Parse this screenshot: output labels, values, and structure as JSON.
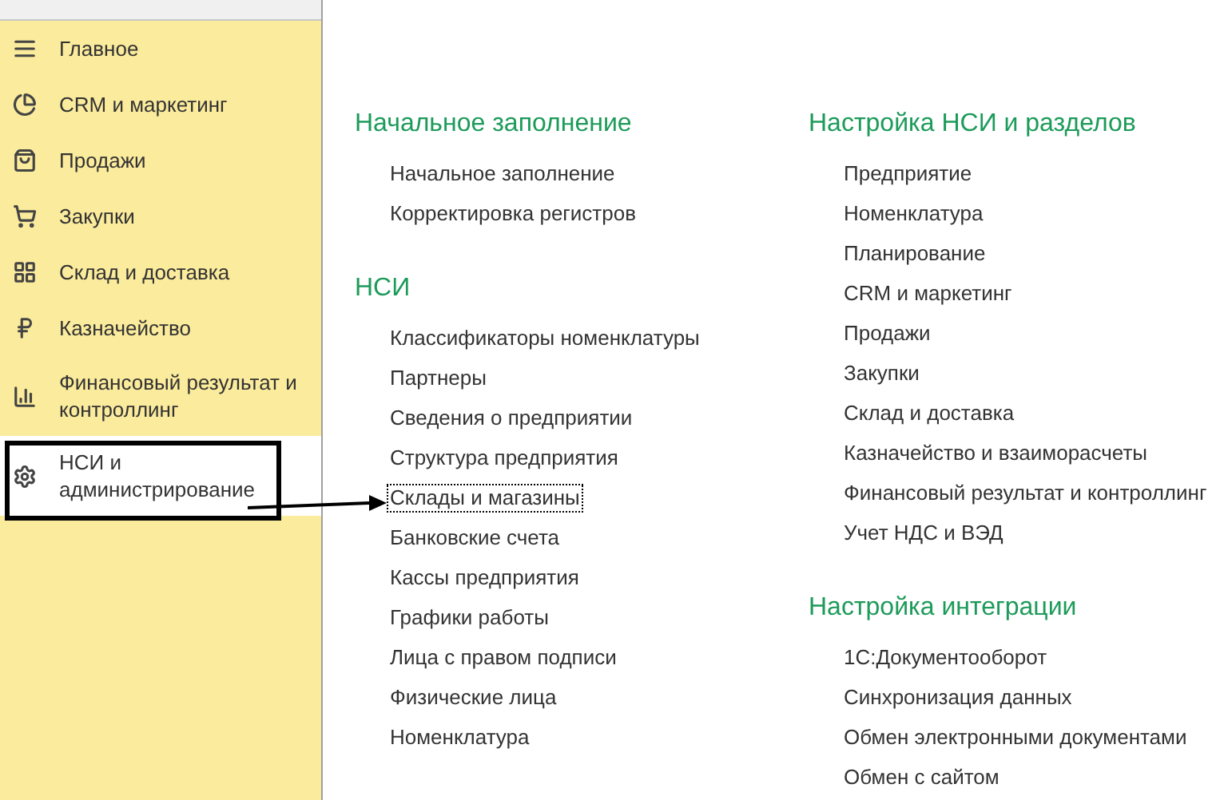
{
  "sidebar": {
    "items": [
      {
        "label": "Главное",
        "selected": false
      },
      {
        "label": "CRM и маркетинг",
        "selected": false
      },
      {
        "label": "Продажи",
        "selected": false
      },
      {
        "label": "Закупки",
        "selected": false
      },
      {
        "label": "Склад и доставка",
        "selected": false
      },
      {
        "label": "Казначейство",
        "selected": false
      },
      {
        "label": "Финансовый результат и контроллинг",
        "selected": false
      },
      {
        "label": "НСИ и администрирование",
        "selected": true
      }
    ]
  },
  "columns": [
    {
      "sections": [
        {
          "title": "Начальное заполнение",
          "links": [
            {
              "label": "Начальное заполнение",
              "focused": false
            },
            {
              "label": "Корректировка регистров",
              "focused": false
            }
          ]
        },
        {
          "title": "НСИ",
          "links": [
            {
              "label": "Классификаторы номенклатуры",
              "focused": false
            },
            {
              "label": "Партнеры",
              "focused": false
            },
            {
              "label": "Сведения о предприятии",
              "focused": false
            },
            {
              "label": "Структура предприятия",
              "focused": false
            },
            {
              "label": "Склады и магазины",
              "focused": true
            },
            {
              "label": "Банковские счета",
              "focused": false
            },
            {
              "label": "Кассы предприятия",
              "focused": false
            },
            {
              "label": "Графики работы",
              "focused": false
            },
            {
              "label": "Лица с правом подписи",
              "focused": false
            },
            {
              "label": "Физические лица",
              "focused": false
            },
            {
              "label": "Номенклатура",
              "focused": false
            }
          ]
        }
      ]
    },
    {
      "sections": [
        {
          "title": "Настройка НСИ и разделов",
          "links": [
            {
              "label": "Предприятие",
              "focused": false
            },
            {
              "label": "Номенклатура",
              "focused": false
            },
            {
              "label": "Планирование",
              "focused": false
            },
            {
              "label": "CRM и маркетинг",
              "focused": false
            },
            {
              "label": "Продажи",
              "focused": false
            },
            {
              "label": "Закупки",
              "focused": false
            },
            {
              "label": "Склад и доставка",
              "focused": false
            },
            {
              "label": "Казначейство и взаиморасчеты",
              "focused": false
            },
            {
              "label": "Финансовый результат и контроллинг",
              "focused": false
            },
            {
              "label": "Учет НДС и ВЭД",
              "focused": false
            }
          ]
        },
        {
          "title": "Настройка интеграции",
          "links": [
            {
              "label": "1С:Документооборот",
              "focused": false
            },
            {
              "label": "Синхронизация данных",
              "focused": false
            },
            {
              "label": "Обмен электронными документами",
              "focused": false
            },
            {
              "label": "Обмен с сайтом",
              "focused": false
            }
          ]
        }
      ]
    }
  ]
}
